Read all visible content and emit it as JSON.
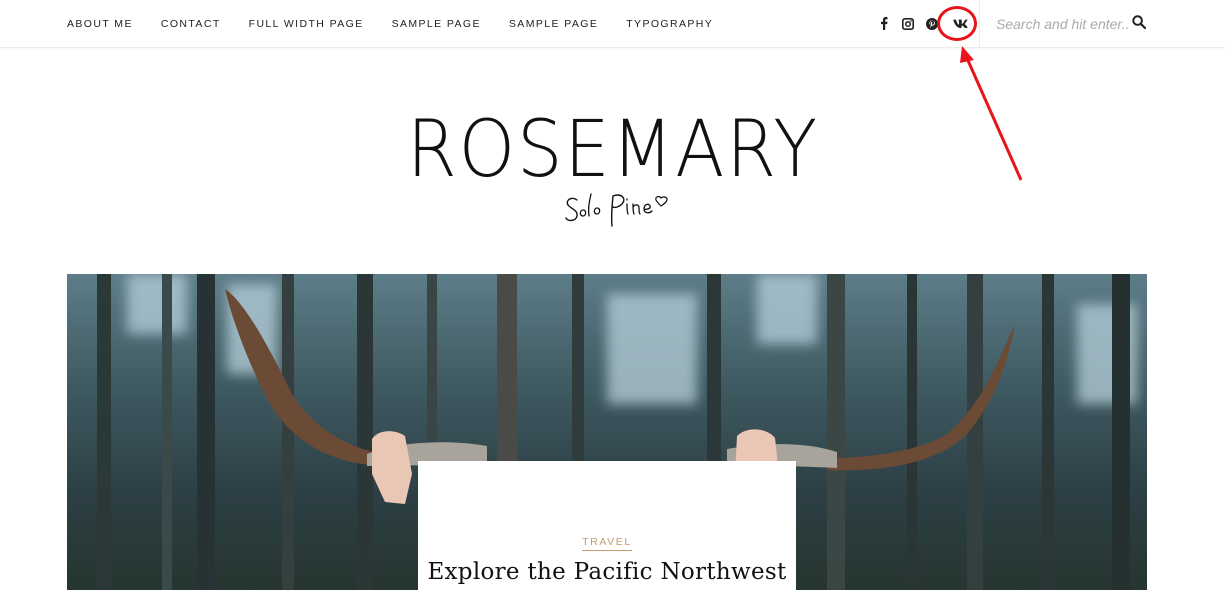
{
  "nav": {
    "items": [
      {
        "label": "ABOUT ME"
      },
      {
        "label": "CONTACT"
      },
      {
        "label": "FULL WIDTH PAGE"
      },
      {
        "label": "SAMPLE PAGE"
      },
      {
        "label": "SAMPLE PAGE"
      },
      {
        "label": "TYPOGRAPHY"
      }
    ]
  },
  "social": {
    "icons": [
      "facebook-icon",
      "instagram-icon",
      "pinterest-icon",
      "vk-icon"
    ]
  },
  "search": {
    "placeholder": "Search and hit enter...",
    "value": ""
  },
  "logo": {
    "title": "ROSEMARY",
    "subtitle": "Solo Pine"
  },
  "featured_post": {
    "category": "TRAVEL",
    "title": "Explore the Pacific Northwest"
  },
  "colors": {
    "accent": "#c69a6d",
    "annotation": "#e8141a",
    "text": "#222222"
  }
}
